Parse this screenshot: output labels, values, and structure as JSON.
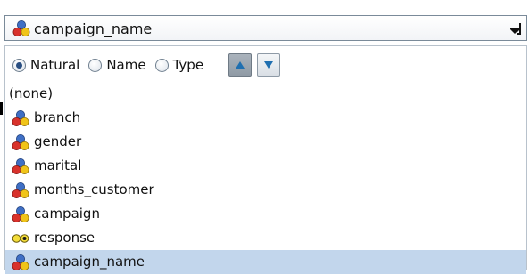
{
  "selector": {
    "value": "campaign_name",
    "value_icon": "nominal-field-icon"
  },
  "sort": {
    "options": [
      {
        "label": "Natural",
        "selected": true
      },
      {
        "label": "Name",
        "selected": false
      },
      {
        "label": "Type",
        "selected": false
      }
    ],
    "asc_icon": "sort-ascending-icon",
    "desc_icon": "sort-descending-icon"
  },
  "list": {
    "items": [
      {
        "label": "(none)",
        "icon": ""
      },
      {
        "label": "branch",
        "icon": "nominal-field-icon"
      },
      {
        "label": "gender",
        "icon": "nominal-field-icon"
      },
      {
        "label": "marital",
        "icon": "nominal-field-icon"
      },
      {
        "label": "months_customer",
        "icon": "nominal-field-icon"
      },
      {
        "label": "campaign",
        "icon": "nominal-field-icon"
      },
      {
        "label": "response",
        "icon": "flag-field-icon"
      },
      {
        "label": "campaign_name",
        "icon": "nominal-field-icon",
        "selected": true
      }
    ]
  },
  "colors": {
    "selection": "#c2d6ec",
    "nominal_red": "#d8322c",
    "nominal_blue": "#3f6fc4",
    "nominal_yellow": "#f0c419",
    "flag_yellow": "#f3dd3a"
  }
}
